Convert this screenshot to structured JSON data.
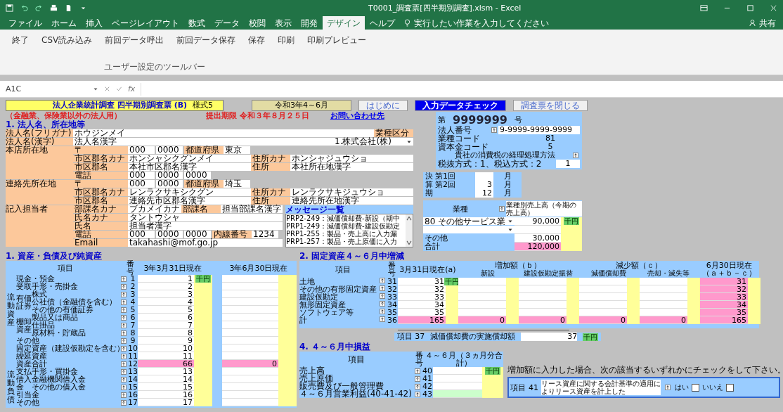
{
  "window": {
    "title": "T0001_調査票[四半期別調査].xlsm - Excel",
    "share": "共有"
  },
  "tabs": [
    {
      "label": "ファイル",
      "selected": false
    },
    {
      "label": "ホーム",
      "selected": false
    },
    {
      "label": "挿入",
      "selected": false
    },
    {
      "label": "ページレイアウト",
      "selected": false
    },
    {
      "label": "数式",
      "selected": false
    },
    {
      "label": "データ",
      "selected": false
    },
    {
      "label": "校閲",
      "selected": false
    },
    {
      "label": "表示",
      "selected": false
    },
    {
      "label": "開発",
      "selected": false
    },
    {
      "label": "デザイン",
      "selected": true
    },
    {
      "label": "ヘルプ",
      "selected": false
    }
  ],
  "tell_me": "実行したい作業を入力してください",
  "commands": [
    "終了",
    "CSV読み込み",
    "前回データ呼出",
    "前回データ保存",
    "保存",
    "印刷",
    "印刷プレビュー"
  ],
  "group_label": "ユーザー設定のツールバー",
  "formula_bar": {
    "name_box": "A1C",
    "function_label": "fx"
  },
  "header": {
    "form_title": "法人企業統計調査 四半期別調査票 (B)",
    "form_code": "様式5",
    "period": "令和3年4～6月",
    "buttons": [
      {
        "label": "はじめに",
        "kind": "plain"
      },
      {
        "label": "入力データチェック",
        "kind": "primary"
      },
      {
        "label": "調査票を閉じる",
        "kind": "plain"
      }
    ]
  },
  "notes": {
    "scope": "（金融業、保険業以外の法人用）",
    "deadline": "提出期限 令和３年８月２５日",
    "contact_link": "お問い合わせ先"
  },
  "section1": {
    "title": "1. 法人名、所在地等",
    "groups": [
      {
        "label": "法人名(フリガナ)",
        "rows": [
          {
            "fields": [
              {
                "kind": "value",
                "text": "ホウジンメイ"
              }
            ],
            "side_label": "業種区分"
          }
        ]
      },
      {
        "label": "法人名(漢字)",
        "rows": [
          {
            "fields": [
              {
                "kind": "value",
                "text": "法人名漢字"
              }
            ],
            "side_fields": [
              {
                "kind": "select",
                "text": "1.株式会社(株)"
              }
            ]
          }
        ]
      },
      {
        "label": "本店所在地",
        "rows": [
          {
            "sub": "〒",
            "fields": [
              {
                "kind": "short",
                "text": "000"
              },
              {
                "kind": "short",
                "text": "0000"
              }
            ],
            "side_label": "都道府県",
            "side_fields": [
              {
                "kind": "short",
                "text": "東京"
              }
            ]
          },
          {
            "sub": "市区郡名カナ",
            "fields": [
              {
                "kind": "value",
                "text": "ホンシャシクグンメイ"
              }
            ],
            "side_label": "住所カナ",
            "side_fields": [
              {
                "kind": "value",
                "text": "ホンシャジュウショ"
              }
            ]
          },
          {
            "sub": "市区郡名",
            "fields": [
              {
                "kind": "value",
                "text": "本社市区郡名漢字"
              }
            ],
            "side_label": "住所",
            "side_fields": [
              {
                "kind": "value",
                "text": "本社所在地漢字"
              }
            ]
          },
          {
            "sub": "電話",
            "fields": [
              {
                "kind": "short",
                "text": "000"
              },
              {
                "kind": "short",
                "text": "0000"
              },
              {
                "kind": "short",
                "text": "0000"
              }
            ]
          }
        ]
      },
      {
        "label": "連絡先所在地",
        "rows": [
          {
            "sub": "〒",
            "fields": [
              {
                "kind": "short",
                "text": "000"
              },
              {
                "kind": "short",
                "text": "0000"
              }
            ],
            "side_label": "都道府県",
            "side_fields": [
              {
                "kind": "short",
                "text": "埼玉"
              }
            ]
          },
          {
            "sub": "市区郡名カナ",
            "fields": [
              {
                "kind": "value",
                "text": "レンラクサキシクグン"
              }
            ],
            "side_label": "住所カナ",
            "side_fields": [
              {
                "kind": "value",
                "text": "レンラクサキジュウショ"
              }
            ]
          },
          {
            "sub": "市区郡名",
            "fields": [
              {
                "kind": "value",
                "text": "連絡先市区郡名漢字"
              }
            ],
            "side_label": "住所",
            "side_fields": [
              {
                "kind": "value",
                "text": "連絡先所在地漢字"
              }
            ]
          }
        ]
      }
    ],
    "contact_groups": [
      {
        "label": "記入担当者",
        "rows": [
          {
            "sub": "部課名カナ",
            "fields": [
              {
                "kind": "value",
                "text": "ブカメイカナ"
              }
            ],
            "side_label": "部課名",
            "side_fields": [
              {
                "kind": "value",
                "text": "担当部課名漢字"
              }
            ]
          },
          {
            "sub": "氏名カナ",
            "fields": [
              {
                "kind": "value",
                "text": "タントウシャ"
              }
            ]
          },
          {
            "sub": "氏名",
            "fields": [
              {
                "kind": "value",
                "text": "担当者漢字"
              }
            ]
          },
          {
            "sub": "電話",
            "fields": [
              {
                "kind": "short",
                "text": "000"
              },
              {
                "kind": "short",
                "text": "0000"
              },
              {
                "kind": "short",
                "text": "0000"
              }
            ],
            "side_label": "内線番号",
            "side_fields": [
              {
                "kind": "short",
                "text": "1234"
              }
            ]
          },
          {
            "sub": "Email",
            "fields": [
              {
                "kind": "value",
                "text": "takahashi@mof.go.jp"
              }
            ]
          }
        ]
      }
    ]
  },
  "messages": {
    "title": "メッセージ一覧",
    "lines": [
      "PRP2-249：減価償却費-新設（期中",
      "PRP1-249：減価償却費-建設仮勘定",
      "PRP1-255：製品・売上高に入力漏",
      "PRP1-257：製品・売上原価に入力"
    ]
  },
  "info": {
    "number_prefix": "第",
    "number": "9999999",
    "number_suffix": "号",
    "corporate_number_label": "法人番号",
    "corporate_number": "9-9999-9999-9999",
    "rows": [
      {
        "label": "業種コード",
        "value": "81"
      },
      {
        "label": "資本金コード",
        "value": "5"
      }
    ],
    "tax_method_label": "貴社の消費税の経理処理方法",
    "tax_method_hint": "税抜方式：1、税込方式：2",
    "tax_method": "1"
  },
  "fiscal": {
    "label": "決算期",
    "rows": [
      {
        "label": "第1回",
        "unit": "月"
      },
      {
        "label": "第2回",
        "value": "3",
        "unit": "月"
      },
      {
        "value": "12",
        "unit": "月"
      }
    ]
  },
  "industry": {
    "header": "業種",
    "sales_header": "業種別売上高（今期の売上高）",
    "badge": "千円",
    "rows": [
      {
        "kind": "select",
        "text": "80 その他サービス業",
        "value": "90,000"
      },
      {
        "kind": "select"
      },
      {
        "kind": "other",
        "text": "その他",
        "value": "30,000"
      },
      {
        "kind": "total",
        "text": "合計",
        "value": "120,000"
      }
    ]
  },
  "table1": {
    "title": "1. 資産・負債及び純資産",
    "columns": [
      "項目",
      "番号",
      "3年3月31日現在",
      "3年6月30日現在"
    ],
    "badge": "千円",
    "sections": [
      {
        "label": "流動資産",
        "rows": [
          {
            "item": "現金・預金",
            "no": "1",
            "march": "1"
          },
          {
            "item": "受取手形・売掛金",
            "no": "2",
            "march": "2"
          },
          {
            "label": "有価証券",
            "children": [
              {
                "item": "株式",
                "no": "3",
                "march": "3"
              },
              {
                "item": "公社債（金融債を含む）",
                "no": "4",
                "march": "4"
              },
              {
                "item": "その他の有価証券",
                "no": "5",
                "march": "5"
              }
            ]
          },
          {
            "label": "棚卸資産",
            "children": [
              {
                "item": "製品又は商品",
                "no": "6",
                "march": "6"
              },
              {
                "item": "仕掛品",
                "no": "7",
                "march": "7"
              },
              {
                "item": "原材料・貯蔵品",
                "no": "8",
                "march": "8"
              }
            ]
          },
          {
            "item": "その他",
            "no": "9",
            "march": "9"
          }
        ]
      },
      {
        "rows": [
          {
            "item": "固定資産（建設仮勘定を含む）",
            "no": "10",
            "march": "10"
          },
          {
            "item": "繰延資産",
            "no": "11",
            "march": "11"
          },
          {
            "item": "資産合計",
            "no": "12",
            "march": "66",
            "june": "0",
            "kind": "total"
          }
        ]
      },
      {
        "label": "流動負債",
        "rows": [
          {
            "item": "支払手形・買掛金",
            "no": "13",
            "march": "13"
          },
          {
            "label": "借入金",
            "children": [
              {
                "item": "金融機関借入金",
                "no": "14",
                "march": "14"
              },
              {
                "item": "その他の借入金",
                "no": "15",
                "march": "15"
              }
            ]
          },
          {
            "item": "引当金",
            "no": "16",
            "march": "16"
          },
          {
            "item": "その他",
            "no": "17",
            "march": "17"
          }
        ]
      }
    ]
  },
  "table2": {
    "title": "2. 固定資産４～６月中増減",
    "item_header": "項目",
    "no_header": "番号",
    "start_header": "3月31日現在(a)",
    "increase_header": "増加額（ｂ）",
    "decrease_header": "減少額（ｃ）",
    "sub_headers": [
      "新設",
      "建設仮勘定振替",
      "減価償却費",
      "売却・滅失等"
    ],
    "end_header": "6月30日現在（ａ＋ｂ－ｃ）",
    "badge": "千円",
    "rows": [
      {
        "item": "土地",
        "no": "31",
        "start": "31",
        "end": "31"
      },
      {
        "item": "その他の有形固定資産",
        "no": "32",
        "start": "32",
        "end": "32"
      },
      {
        "item": "建設仮勘定",
        "no": "33",
        "start": "33",
        "end": "33"
      },
      {
        "item": "無形固定資産",
        "no": "34",
        "start": "34",
        "end": "34"
      },
      {
        "item": "ソフトウェア等",
        "no": "35",
        "start": "35",
        "end": "35"
      },
      {
        "item": "計",
        "no": "36",
        "start": "165",
        "changes": [
          "0",
          "0",
          "0",
          "0"
        ],
        "end": "165",
        "kind": "total"
      }
    ]
  },
  "depreciation": {
    "label": "項目 37",
    "text": "減価償却費の実施償却額",
    "value": "37",
    "badge": "千円"
  },
  "table4": {
    "title": "4. ４～６月中損益",
    "columns": [
      "項目",
      "番号",
      "４～６月（３ヵ月分合計）"
    ],
    "badge": "千円",
    "rows": [
      {
        "item": "売上高",
        "no": "40"
      },
      {
        "item": "売上原価",
        "no": "41"
      },
      {
        "item": "販売費及び一般管理費",
        "no": "42"
      },
      {
        "item": "４～６月営業利益(40-41-42)",
        "no": "43",
        "kind": "calc"
      }
    ]
  },
  "increase_note": {
    "text": "増加額に入力した場合、次の該当するいずれかにチェックをして下さい。",
    "label": "項目",
    "no": "41",
    "question": "リース資産に関する会計基準の適用によりリース資産を計上した",
    "options": [
      {
        "label": "はい",
        "checked": false
      },
      {
        "label": "いいえ",
        "checked": false
      }
    ]
  }
}
